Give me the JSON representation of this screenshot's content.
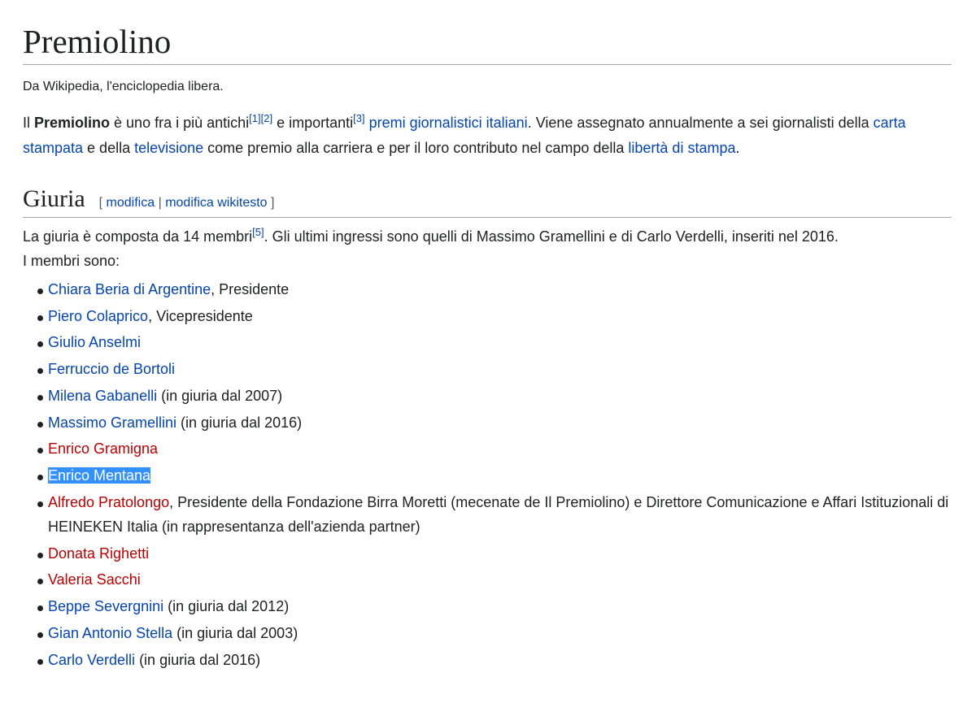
{
  "article": {
    "title": "Premiolino",
    "tagline": "Da Wikipedia, l'enciclopedia libera."
  },
  "lead": {
    "p1": "Il ",
    "bold": "Premiolino",
    "p2": " è uno fra i più antichi",
    "ref1": "[1]",
    "ref2": "[2]",
    "p3": " e importanti",
    "ref3": "[3]",
    "p4": " ",
    "link1": "premi giornalistici italiani",
    "p5": ". Viene assegnato annualmente a sei giornalisti della ",
    "link2": "carta stampata",
    "p6": " e della ",
    "link3": "televisione",
    "p7": " come premio alla carriera e per il loro contributo nel campo della ",
    "link4": "libertà di stampa",
    "p8": "."
  },
  "section": {
    "title": "Giuria",
    "bracket_open": "[",
    "edit": "modifica",
    "sep": "|",
    "edit_source": "modifica wikitesto",
    "bracket_close": "]"
  },
  "jury": {
    "s1": "La giuria è composta da 14 membri",
    "ref5": "[5]",
    "s2": ". Gli ultimi ingressi sono quelli di Massimo Gramellini e di Carlo Verdelli, inseriti nel 2016.",
    "s3": "I membri sono:"
  },
  "members": [
    {
      "name": "Chiara Beria di Argentine",
      "rest": ", Presidente"
    },
    {
      "name": "Piero Colaprico",
      "rest": ", Vicepresidente"
    },
    {
      "name": "Giulio Anselmi",
      "rest": ""
    },
    {
      "name": "Ferruccio de Bortoli",
      "rest": ""
    },
    {
      "name": "Milena Gabanelli",
      "rest": " (in giuria dal 2007)"
    },
    {
      "name": "Massimo Gramellini",
      "rest": " (in giuria dal 2016)"
    },
    {
      "name": "Enrico Gramigna",
      "rest": ""
    },
    {
      "name": "Enrico Mentana",
      "rest": ""
    },
    {
      "name": "Alfredo Pratolongo",
      "rest": ", Presidente della Fondazione Birra Moretti (mecenate de Il Premiolino) e Direttore Comunicazione e Affari Istituzionali di HEINEKEN Italia (in rappresentanza dell'azienda partner)"
    },
    {
      "name": "Donata Righetti",
      "rest": ""
    },
    {
      "name": "Valeria Sacchi",
      "rest": ""
    },
    {
      "name": "Beppe Severgnini",
      "rest": " (in giuria dal 2012)"
    },
    {
      "name": "Gian Antonio Stella",
      "rest": " (in giuria dal 2003)"
    },
    {
      "name": "Carlo Verdelli",
      "rest": " (in giuria dal 2016)"
    }
  ],
  "colors": {
    "link": "#0645ad",
    "new_link": "#ba0000",
    "selection": "#3390ff",
    "text": "#202122",
    "rule": "#a2a9b1"
  }
}
